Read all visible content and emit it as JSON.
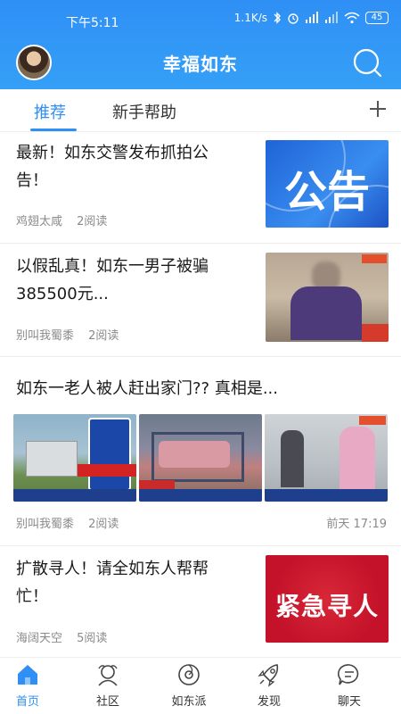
{
  "status_bar": {
    "time": "下午5:11",
    "network_speed": "1.1K/s",
    "battery": "45",
    "icons": [
      "bluetooth-icon",
      "alarm-icon",
      "signal-hd-icon",
      "signal-icon",
      "wifi-icon",
      "battery-icon"
    ]
  },
  "header": {
    "title": "幸福如东",
    "avatar": "avatar",
    "search_icon": "search-icon"
  },
  "tabs": {
    "items": [
      {
        "label": "推荐",
        "active": true
      },
      {
        "label": "新手帮助",
        "active": false
      }
    ],
    "add_icon": "plus-icon",
    "active_color": "#2f8ff5"
  },
  "feed": {
    "articles": [
      {
        "title_line1": "最新！如东交警发布抓拍公",
        "title_line2": "告！",
        "author": "鸡翅太咸",
        "reads": "2阅读",
        "thumbnail_text": "公告"
      },
      {
        "title_line1": "以假乱真！如东一男子被骗",
        "title_line2": "385500元...",
        "author": "别叫我蜀黍",
        "reads": "2阅读"
      },
      {
        "title": "如东一老人被人赶出家门?? 真相是...",
        "author": "别叫我蜀黍",
        "reads": "2阅读",
        "time": "前天 17:19"
      },
      {
        "title_line1": "扩散寻人！请全如东人帮帮",
        "title_line2": "忙！",
        "author": "海阔天空",
        "reads": "5阅读",
        "thumbnail_text": "紧急寻人"
      }
    ]
  },
  "bottom_nav": {
    "items": [
      {
        "label": "首页",
        "icon": "home-icon",
        "active": true
      },
      {
        "label": "社区",
        "icon": "community-icon",
        "active": false
      },
      {
        "label": "如东派",
        "icon": "rudongpai-icon",
        "active": false
      },
      {
        "label": "发现",
        "icon": "rocket-icon",
        "active": false
      },
      {
        "label": "聊天",
        "icon": "chat-icon",
        "active": false
      }
    ]
  },
  "colors": {
    "brand": "#2f8ff5",
    "text_primary": "#1a1a1a",
    "text_meta": "#8a8a8a"
  }
}
